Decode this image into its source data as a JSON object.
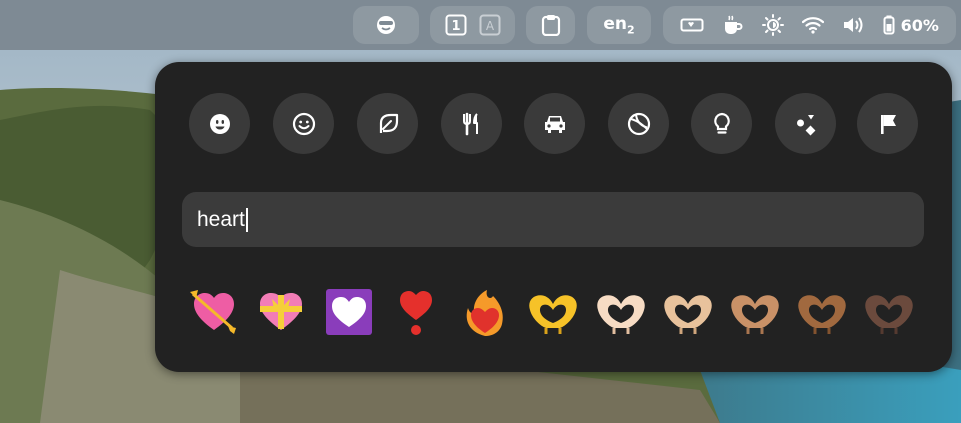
{
  "topbar": {
    "workspaces": [
      "1",
      "A"
    ],
    "language": "en",
    "language_suffix": "2",
    "battery_percent": "60%"
  },
  "picker": {
    "categories": [
      "smileys-icon",
      "people-icon",
      "nature-icon",
      "food-icon",
      "travel-icon",
      "activities-icon",
      "objects-icon",
      "symbols-icon",
      "flags-icon"
    ],
    "search_value": "heart",
    "results": [
      {
        "name": "heart-with-arrow",
        "char": "💘"
      },
      {
        "name": "heart-with-ribbon",
        "char": "💝"
      },
      {
        "name": "white-heart",
        "char": "🤍"
      },
      {
        "name": "heart-exclamation",
        "char": "❣"
      },
      {
        "name": "heart-on-fire",
        "char": "❤️‍🔥"
      },
      {
        "name": "heart-hands",
        "char": "🫶"
      },
      {
        "name": "heart-hands-light",
        "char": "🫶🏻"
      },
      {
        "name": "heart-hands-medium-light",
        "char": "🫶🏼"
      },
      {
        "name": "heart-hands-medium",
        "char": "🫶🏽"
      },
      {
        "name": "heart-hands-medium-dark",
        "char": "🫶🏾"
      },
      {
        "name": "heart-hands-dark",
        "char": "🫶🏿"
      }
    ]
  }
}
